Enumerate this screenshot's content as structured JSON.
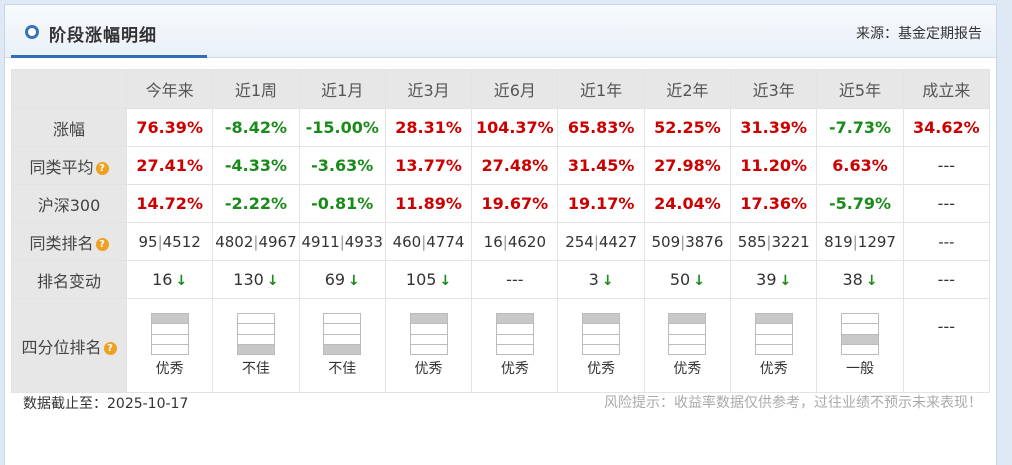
{
  "header": {
    "title": "阶段涨幅明细",
    "source": "来源：基金定期报告"
  },
  "table": {
    "columns": [
      "今年来",
      "近1周",
      "近1月",
      "近3月",
      "近6月",
      "近1年",
      "近2年",
      "近3年",
      "近5年",
      "成立来"
    ],
    "rows": {
      "gain": {
        "label": "涨幅",
        "values": [
          "76.39%",
          "-8.42%",
          "-15.00%",
          "28.31%",
          "104.37%",
          "65.83%",
          "52.25%",
          "31.39%",
          "-7.73%",
          "34.62%"
        ]
      },
      "peer_avg": {
        "label": "同类平均",
        "values": [
          "27.41%",
          "-4.33%",
          "-3.63%",
          "13.77%",
          "27.48%",
          "31.45%",
          "27.98%",
          "11.20%",
          "6.63%",
          "---"
        ]
      },
      "hs300": {
        "label": "沪深300",
        "values": [
          "14.72%",
          "-2.22%",
          "-0.81%",
          "11.89%",
          "19.67%",
          "19.17%",
          "24.04%",
          "17.36%",
          "-5.79%",
          "---"
        ]
      },
      "peer_rank": {
        "label": "同类排名",
        "values": [
          {
            "rank": "95",
            "total": "4512"
          },
          {
            "rank": "4802",
            "total": "4967"
          },
          {
            "rank": "4911",
            "total": "4933"
          },
          {
            "rank": "460",
            "total": "4774"
          },
          {
            "rank": "16",
            "total": "4620"
          },
          {
            "rank": "254",
            "total": "4427"
          },
          {
            "rank": "509",
            "total": "3876"
          },
          {
            "rank": "585",
            "total": "3221"
          },
          {
            "rank": "819",
            "total": "1297"
          },
          null
        ],
        "empty": "---"
      },
      "rank_change": {
        "label": "排名变动",
        "values": [
          "16",
          "130",
          "69",
          "105",
          "---",
          "3",
          "50",
          "39",
          "38",
          "---"
        ],
        "arrow": [
          "down",
          "down",
          "down",
          "down",
          null,
          "down",
          "down",
          "down",
          "down",
          null
        ],
        "arrow_icon": "↓"
      },
      "quartile": {
        "label": "四分位排名",
        "values": [
          {
            "level": 1,
            "text": "优秀"
          },
          {
            "level": 4,
            "text": "不佳"
          },
          {
            "level": 4,
            "text": "不佳"
          },
          {
            "level": 1,
            "text": "优秀"
          },
          {
            "level": 1,
            "text": "优秀"
          },
          {
            "level": 1,
            "text": "优秀"
          },
          {
            "level": 1,
            "text": "优秀"
          },
          {
            "level": 1,
            "text": "优秀"
          },
          {
            "level": 3,
            "text": "一般"
          },
          null
        ],
        "empty": "---"
      }
    },
    "help_icon": "?"
  },
  "footer": {
    "date_label": "数据截止至：2025-10-17",
    "risk": "风险提示：收益率数据仅供参考，过往业绩不预示未来表现！"
  },
  "colors": {
    "up": "#cc0000",
    "down": "#1a8a1a",
    "accent": "#2f6fb8",
    "help": "#f0a020"
  }
}
